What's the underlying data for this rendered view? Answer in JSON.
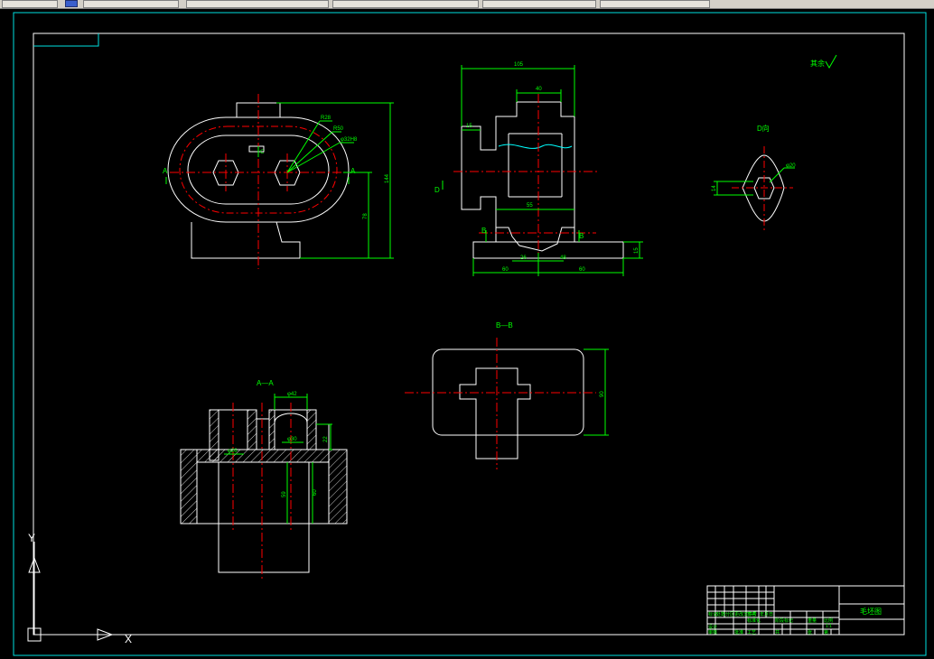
{
  "colors": {
    "background": "#000000",
    "outline": "#ffffff",
    "centerline": "#ff0000",
    "dimension": "#00ff00",
    "border": "#00e0e0",
    "hidden": "#00ffff"
  },
  "toolbar": {
    "items": [
      "",
      "",
      "",
      "",
      ""
    ]
  },
  "labels": {
    "roughness": "其余",
    "view_d": "D向",
    "section_aa": "A—A",
    "section_bb": "B—B",
    "mark_a_left": "A",
    "mark_a_right": "A",
    "mark_b_left": "B",
    "mark_b_right": "B",
    "mark_d": "D",
    "mark_c": "C"
  },
  "dimensions": {
    "front": {
      "r28": "R28",
      "r50": "R50",
      "phi": "φ32H8",
      "h144": "144",
      "h78": "78"
    },
    "side": {
      "w105": "105",
      "w40": "40",
      "w15": "15",
      "w55": "55",
      "w26": "26",
      "w48": "48",
      "w60a": "60",
      "w60b": "60",
      "h15": "15"
    },
    "dview": {
      "phi20": "φ20",
      "h14": "14"
    },
    "aa": {
      "phi42": "φ42",
      "phi30": "φ30",
      "phi26": "φ26",
      "d22": "22",
      "d59": "59",
      "d60": "60"
    },
    "bb": {
      "d90": "90"
    }
  },
  "title_block": {
    "drawing_name": "毛坯图",
    "scale": "1:1",
    "cells": [
      "标记",
      "处数",
      "分区",
      "更改文件号",
      "签名",
      "年月日",
      "设计",
      "标准化",
      "阶段标记",
      "重量",
      "比例",
      "审核",
      "工艺",
      "批准",
      "共",
      "张",
      "第"
    ]
  },
  "ucs": {
    "y": "Y",
    "x": "X"
  }
}
